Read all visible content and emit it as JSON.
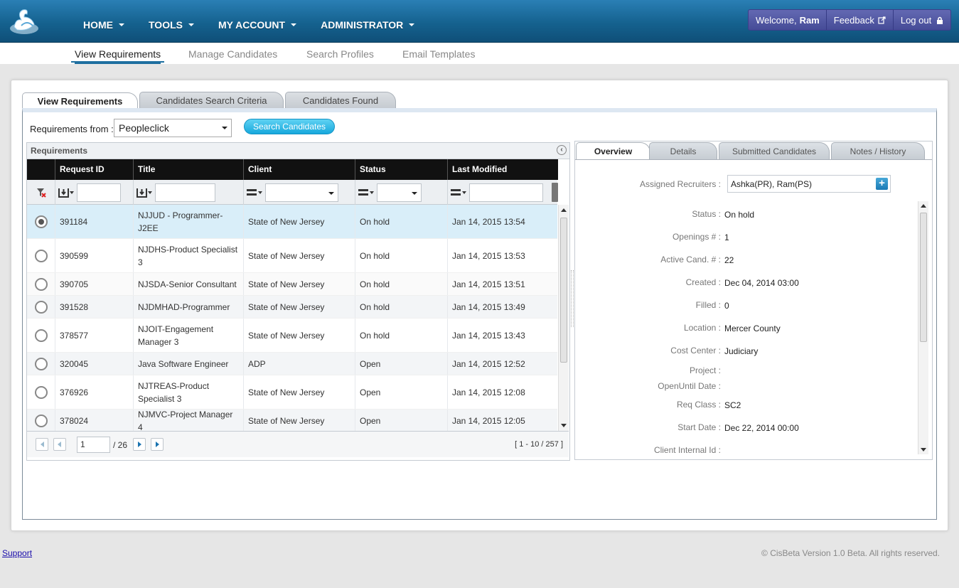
{
  "header": {
    "nav": [
      {
        "label": "HOME"
      },
      {
        "label": "TOOLS"
      },
      {
        "label": "MY ACCOUNT"
      },
      {
        "label": "ADMINISTRATOR"
      }
    ],
    "welcome_prefix": "Welcome,",
    "user_name": "Ram",
    "feedback_label": "Feedback",
    "logout_label": "Log out"
  },
  "subnav": [
    {
      "label": "View Requirements",
      "active": true
    },
    {
      "label": "Manage Candidates"
    },
    {
      "label": "Search Profiles"
    },
    {
      "label": "Email Templates"
    }
  ],
  "main_tabs": [
    {
      "label": "View Requirements",
      "active": true
    },
    {
      "label": "Candidates Search Criteria"
    },
    {
      "label": "Candidates Found"
    }
  ],
  "filter": {
    "requirements_from_label": "Requirements from :",
    "source_value": "Peopleclick",
    "search_button": "Search Candidates"
  },
  "grid": {
    "title": "Requirements",
    "columns": [
      "Request ID",
      "Title",
      "Client",
      "Status",
      "Last Modified"
    ],
    "rows": [
      {
        "selected": true,
        "id": "391184",
        "title": "NJJUD - Programmer-J2EE",
        "client": "State of New Jersey",
        "status": "On hold",
        "modified": "Jan 14, 2015 13:54"
      },
      {
        "id": "390599",
        "title": "NJDHS-Product Specialist 3",
        "client": "State of New Jersey",
        "status": "On hold",
        "modified": "Jan 14, 2015 13:53"
      },
      {
        "id": "390705",
        "title": "NJSDA-Senior Consultant",
        "client": "State of New Jersey",
        "status": "On hold",
        "modified": "Jan 14, 2015 13:51"
      },
      {
        "id": "391528",
        "title": "NJDMHAD-Programmer",
        "client": "State of New Jersey",
        "status": "On hold",
        "modified": "Jan 14, 2015 13:49"
      },
      {
        "id": "378577",
        "title": "NJOIT-Engagement Manager 3",
        "client": "State of New Jersey",
        "status": "On hold",
        "modified": "Jan 14, 2015 13:43"
      },
      {
        "id": "320045",
        "title": "Java Software Engineer",
        "client": "ADP",
        "status": "Open",
        "modified": "Jan 14, 2015 12:52"
      },
      {
        "id": "376926",
        "title": "NJTREAS-Product Specialist 3",
        "client": "State of New Jersey",
        "status": "Open",
        "modified": "Jan 14, 2015 12:08"
      },
      {
        "id": "378024",
        "title": "NJMVC-Project Manager 4",
        "client": "State of New Jersey",
        "status": "Open",
        "modified": "Jan 14, 2015 12:05"
      }
    ],
    "pager": {
      "page_value": "1",
      "total_pages": "/ 26",
      "range_text": "[ 1 - 10 / 257 ]"
    }
  },
  "detail": {
    "tabs": [
      {
        "label": "Overview",
        "active": true
      },
      {
        "label": "Details"
      },
      {
        "label": "Submitted Candidates"
      },
      {
        "label": "Notes / History"
      }
    ],
    "recruiters_label": "Assigned Recruiters :",
    "recruiters_value": "Ashka(PR), Ram(PS)",
    "fields": [
      {
        "label": "Status :",
        "value": "On hold"
      },
      {
        "label": "Openings # :",
        "value": "1"
      },
      {
        "label": "Active Cand. # :",
        "value": "22"
      },
      {
        "label": "Created :",
        "value": "Dec 04, 2014 03:00"
      },
      {
        "label": "Filled :",
        "value": "0"
      },
      {
        "label": "Location :",
        "value": "Mercer County"
      },
      {
        "label": "Cost Center :",
        "value": "Judiciary"
      },
      {
        "label": "Project :",
        "value": ""
      },
      {
        "label": "OpenUntil Date :",
        "value": ""
      },
      {
        "label": "Req Class :",
        "value": "SC2"
      },
      {
        "label": "Start Date :",
        "value": "Dec 22, 2014 00:00"
      },
      {
        "label": "Client Internal Id :",
        "value": ""
      }
    ]
  },
  "footer": {
    "support_link": "Support",
    "copyright": "© CisBeta Version 1.0 Beta. All rights reserved."
  },
  "colors": {
    "header_blue": "#15628f",
    "selected_row": "#d9eef9",
    "search_button": "#17a8dc",
    "user_box": "#454b97"
  }
}
